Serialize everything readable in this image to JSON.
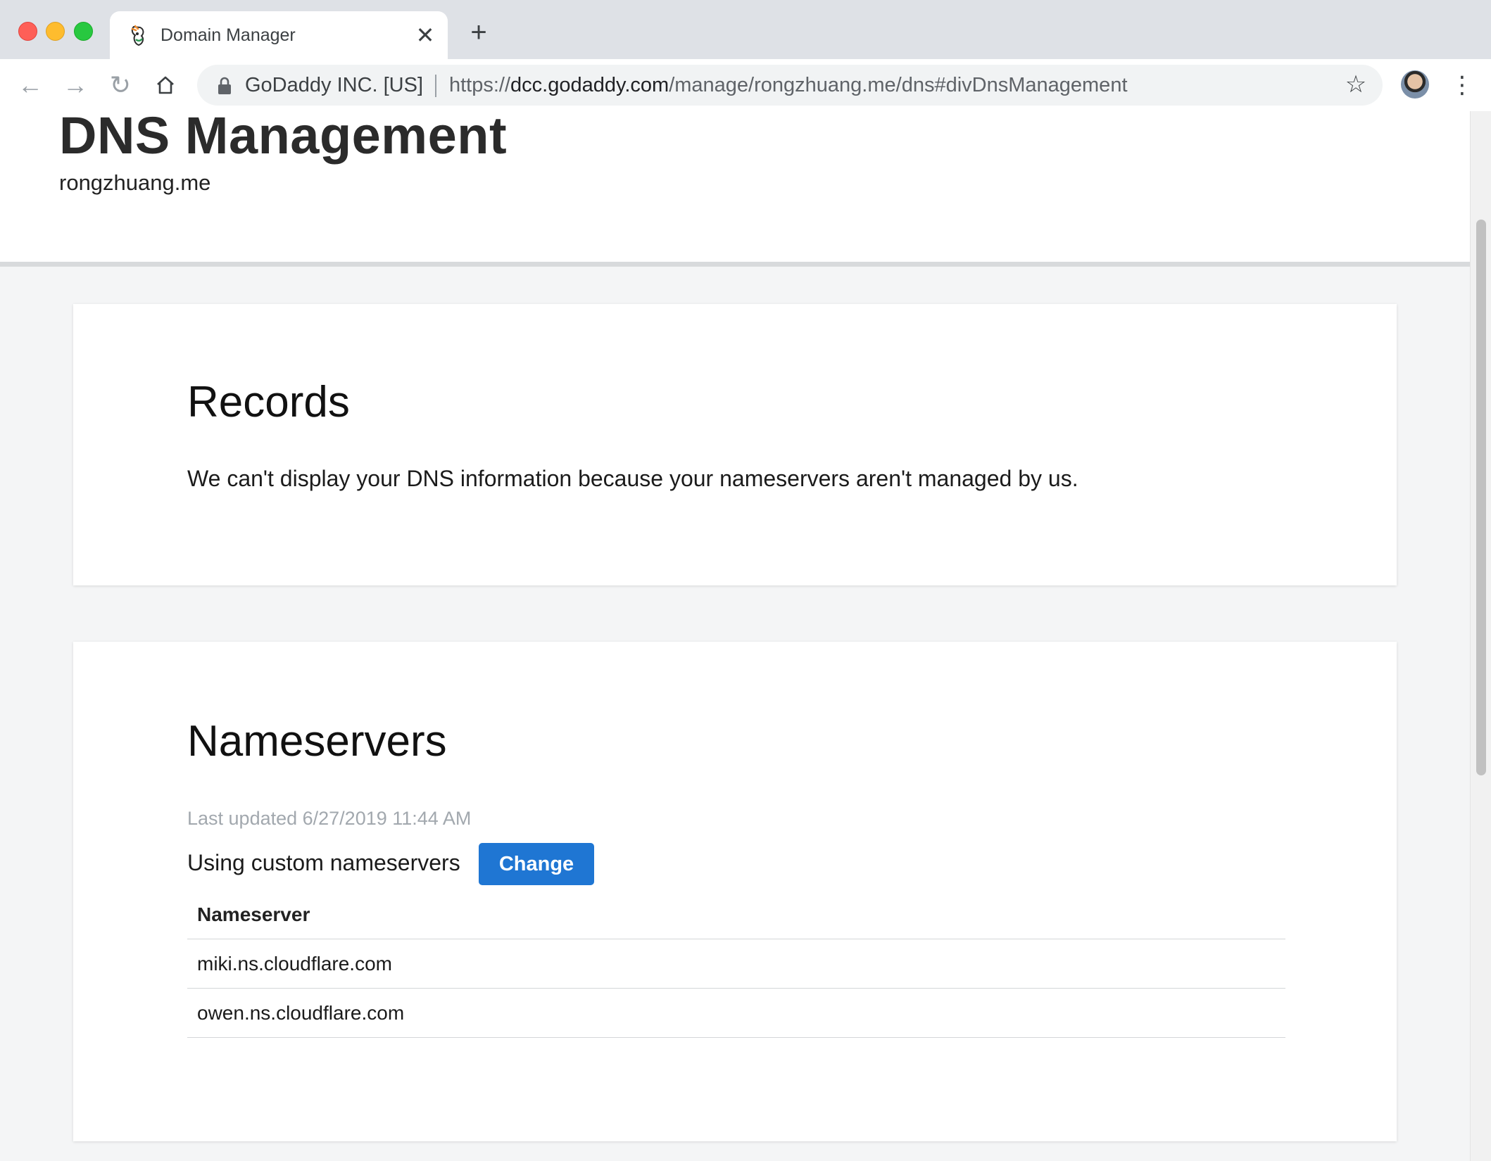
{
  "browser": {
    "tab_title": "Domain Manager",
    "tab_close": "✕",
    "new_tab": "+",
    "site_name": "GoDaddy INC. [US]",
    "url_scheme": "https://",
    "url_host": "dcc.godaddy.com",
    "url_path": "/manage/rongzhuang.me/dns#divDnsManagement",
    "star": "☆",
    "menu": "⋮",
    "nav": {
      "back": "←",
      "forward": "→",
      "reload": "↻",
      "home": "⌂"
    }
  },
  "page": {
    "title": "DNS Management",
    "domain": "rongzhuang.me"
  },
  "records": {
    "heading": "Records",
    "message": "We can't display your DNS information because your nameservers aren't managed by us."
  },
  "nameservers": {
    "heading": "Nameservers",
    "last_updated": "Last updated 6/27/2019 11:44 AM",
    "status": "Using custom nameservers",
    "change_label": "Change",
    "column_header": "Nameserver",
    "rows": [
      "miki.ns.cloudflare.com",
      "owen.ns.cloudflare.com"
    ]
  },
  "colors": {
    "accent": "#1f76d3",
    "muted_text": "#a2a8ae"
  }
}
